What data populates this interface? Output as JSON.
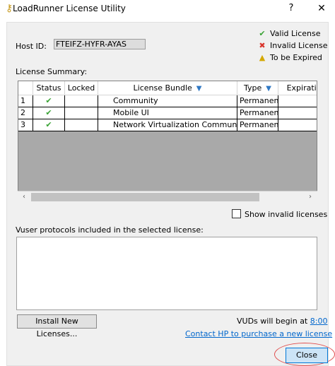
{
  "window": {
    "title": "LoadRunner License Utility",
    "help_label": "?",
    "close_label": "✕"
  },
  "host": {
    "label": "Host ID:",
    "value": "FTEIFZ-HYFR-AYAS"
  },
  "legend": {
    "valid": "Valid License",
    "invalid": "Invalid License",
    "expired": "To be Expired"
  },
  "summary": {
    "label": "License Summary:",
    "columns": [
      "Status",
      "Locked",
      "License Bundle",
      "Type",
      "Expiration"
    ],
    "rows": [
      {
        "num": "1",
        "status": "valid",
        "locked": "",
        "bundle": "Community",
        "type": "Permanent"
      },
      {
        "num": "2",
        "status": "valid",
        "locked": "",
        "bundle": "Mobile UI",
        "type": "Permanent"
      },
      {
        "num": "3",
        "status": "valid",
        "locked": "",
        "bundle": "Network Virtualization Community",
        "type": "Permanent"
      }
    ]
  },
  "show_invalid": {
    "label": "Show invalid licenses",
    "checked": false
  },
  "protocols": {
    "label": "Vuser protocols included in the selected license:"
  },
  "footer": {
    "install_label": "Install New Licenses...",
    "vuds_prefix": "VUDs will begin at ",
    "vuds_time": "8:00",
    "contact_link": "Contact HP to purchase a new license",
    "close_label": "Close"
  },
  "icons": {
    "valid": "check-icon",
    "invalid": "x-icon",
    "expired": "warning-icon",
    "filter": "filter-icon",
    "app": "key-icon"
  },
  "colors": {
    "valid": "#3aa335",
    "invalid": "#d9342b",
    "expired": "#f1c40f",
    "link": "#0066cc",
    "accent": "#0078d7"
  }
}
